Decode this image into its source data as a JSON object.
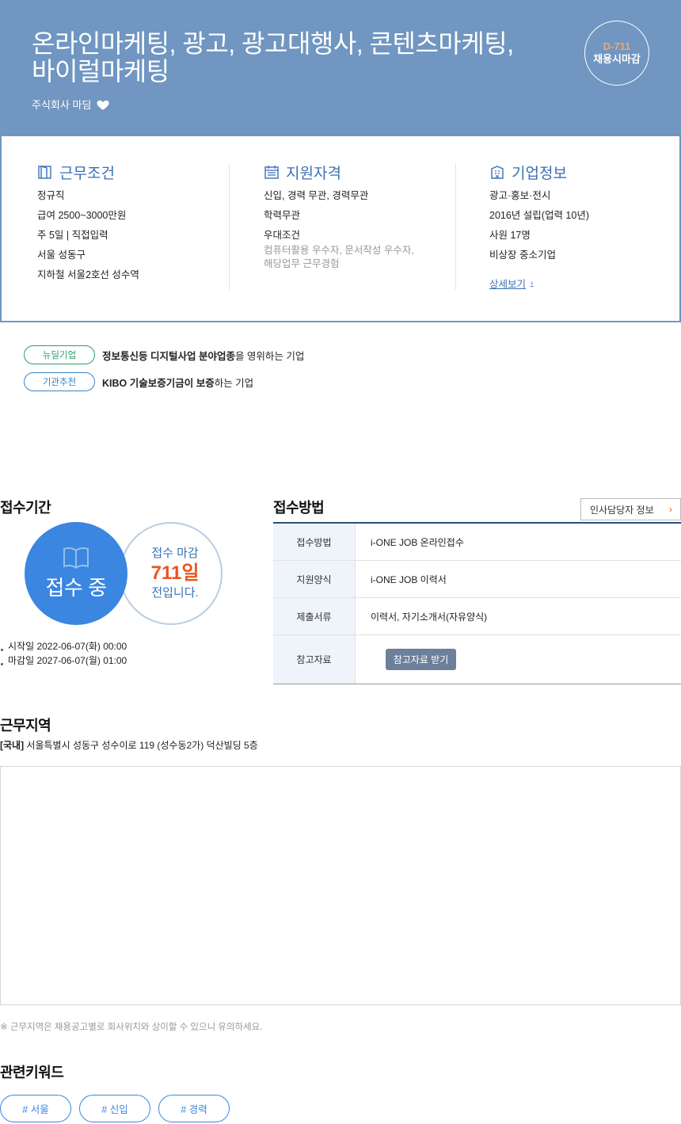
{
  "header": {
    "title_line1": "온라인마케팅, 광고, 광고대행사, 콘텐츠마케팅,",
    "title_line2": "바이럴마케팅",
    "company": "주식회사 마딤",
    "favorite_icon": "heart-icon",
    "dday": "D-711",
    "dday_label": "채용시마감",
    "colors": {
      "hero_bg": "#7096c1",
      "dday_accent": "#f5a56b"
    }
  },
  "summary": {
    "work": {
      "icon": "door-icon",
      "title": "근무조건",
      "lines": [
        "정규직",
        "급여 2500~3000만원",
        "주 5일 | 직접입력",
        "서울 성동구",
        "지하철 서울2호선 성수역"
      ]
    },
    "qualification": {
      "icon": "calendar-icon",
      "title": "지원자격",
      "lines": [
        "신입, 경력 무관, 경력무관",
        "학력무관",
        "우대조건"
      ],
      "preferred_line1": "컴퓨터활용 우수자, 문서작성 우수자,",
      "preferred_line2": "해당업무 근무경험"
    },
    "company": {
      "icon": "building-icon",
      "title": "기업정보",
      "lines": [
        "광고·홍보·전시",
        "2016년 설립(업력 10년)",
        "사원 17명",
        "비상장 중소기업"
      ],
      "more_label": "상세보기",
      "more_chevron": "›"
    }
  },
  "badges": [
    {
      "label": "뉴딜기업",
      "bold": "정보통신등 디지털사업 분야업종",
      "rest": "을 영위하는 기업"
    },
    {
      "label": "기관추천",
      "bold": "KIBO 기술보증기금이 보증",
      "rest": "하는 기업"
    }
  ],
  "period": {
    "title": "접수기간",
    "status": "접수 중",
    "status_icon": "book-icon",
    "deadline_prefix": "접수 마감",
    "deadline_days": "711일",
    "deadline_suffix": "전입니다.",
    "start": "시작일 2022-06-07(화) 00:00",
    "end": "마감일 2027-06-07(월) 01:00",
    "colors": {
      "circle": "#3a86e0",
      "days": "#e8561d"
    }
  },
  "method": {
    "title": "접수방법",
    "hr_button": "인사담당자 정보",
    "hr_chevron": "›",
    "rows": [
      {
        "key": "접수방법",
        "value": "i-ONE JOB 온라인접수"
      },
      {
        "key": "지원양식",
        "value": "i-ONE JOB 이력서"
      },
      {
        "key": "제출서류",
        "value": "이력서, 자기소개서(자유양식)"
      },
      {
        "key": "참고자료",
        "button": "참고자료 받기"
      }
    ]
  },
  "region": {
    "title": "근무지역",
    "tag": "[국내]",
    "address": "서울특별시 성동구 성수이로 119 (성수동2가) 덕산빌딩 5층",
    "note": "※ 근무지역은 채용공고별로 회사위치와 상이할 수 있으니 유의하세요."
  },
  "keywords": {
    "title": "관련키워드",
    "items": [
      "# 서울",
      "# 신입",
      "# 경력"
    ]
  }
}
